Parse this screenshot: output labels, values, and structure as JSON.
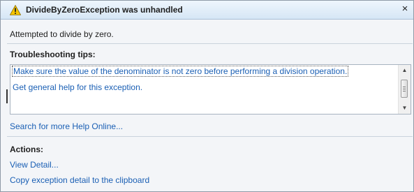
{
  "dialog": {
    "title": "DivideByZeroException was unhandled",
    "close_symbol": "×",
    "message": "Attempted to divide by zero."
  },
  "troubleshooting": {
    "heading": "Troubleshooting tips:",
    "tips": [
      "Make sure the value of the denominator is not zero before performing a division operation.",
      "Get general help for this exception."
    ],
    "search_link": "Search for more Help Online..."
  },
  "actions": {
    "heading": "Actions:",
    "items": [
      "View Detail...",
      "Copy exception detail to the clipboard"
    ]
  },
  "icons": {
    "title_icon": "warning-icon",
    "close_icon": "close-icon",
    "scroll_up": "scroll-up-arrow-icon",
    "scroll_down": "scroll-down-arrow-icon"
  },
  "colors": {
    "link": "#1a5fb4",
    "warning_fill": "#f5c400",
    "title_gradient_top": "#eef6fd",
    "title_gradient_bottom": "#d6e6f5"
  }
}
